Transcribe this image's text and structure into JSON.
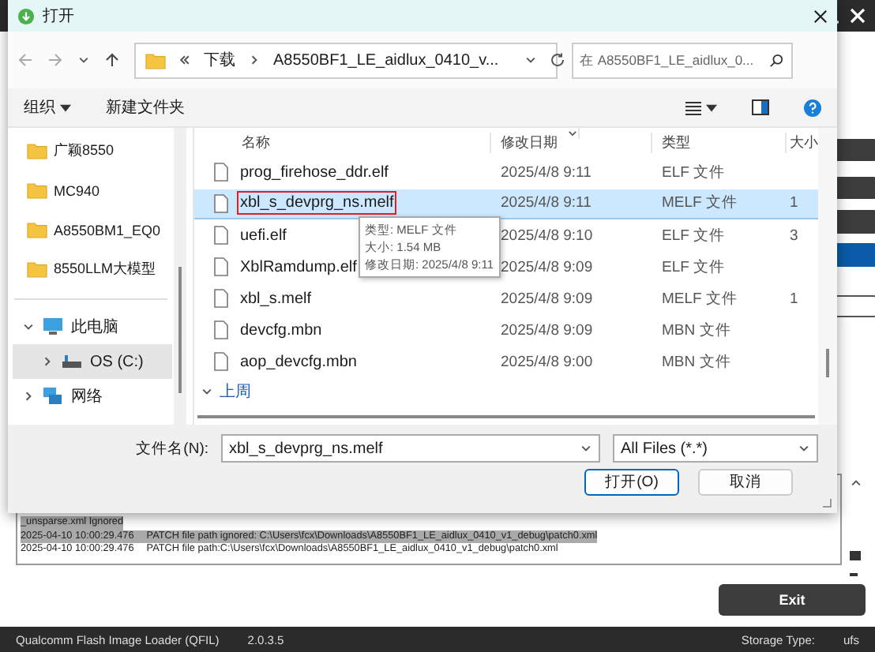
{
  "app": {
    "log_lines": [
      {
        "message": "_unsparse.xml Ignored",
        "selected": true
      },
      {
        "time": "2025-04-10 10:00:29.476",
        "message": "PATCH file path ignored: C:\\Users\\fcx\\Downloads\\A8550BF1_LE_aidlux_0410_v1_debug\\patch0.xml",
        "selected": true
      },
      {
        "time": "2025-04-10 10:00:29.476",
        "message": "PATCH file path:C:\\Users\\fcx\\Downloads\\A8550BF1_LE_aidlux_0410_v1_debug\\patch0.xml",
        "selected": false
      }
    ],
    "exit_button": "Exit",
    "status_bar": {
      "app_name": "Qualcomm Flash Image Loader (QFIL)",
      "version": "2.0.3.5",
      "storage_label": "Storage Type:",
      "storage_value": "ufs"
    }
  },
  "dialog": {
    "title": "打开",
    "breadcrumb": [
      "下载",
      "A8550BF1_LE_aidlux_0410_v..."
    ],
    "search": {
      "placeholder": "在 A8550BF1_LE_aidlux_0..."
    },
    "toolbar": {
      "organize": "组织",
      "new_folder": "新建文件夹"
    },
    "quick_access": [
      {
        "label": "广颖8550"
      },
      {
        "label": "MC940"
      },
      {
        "label": "A8550BM1_EQ0"
      },
      {
        "label": "8550LLM大模型"
      }
    ],
    "tree": [
      {
        "label": "此电脑",
        "expanded": true,
        "selected": false,
        "children": [
          {
            "label": "OS (C:)",
            "expanded": false,
            "selected": true
          }
        ]
      },
      {
        "label": "网络",
        "expanded": false,
        "selected": false
      }
    ],
    "columns": [
      "名称",
      "修改日期",
      "类型",
      "大小"
    ],
    "files": [
      {
        "name": "prog_firehose_ddr.elf",
        "date": "2025/4/8 9:11",
        "type": "ELF 文件",
        "selected": false,
        "annotated": false
      },
      {
        "name": "xbl_s_devprg_ns.melf",
        "date": "2025/4/8 9:11",
        "type": "MELF 文件",
        "size": "1",
        "selected": true,
        "annotated": true
      },
      {
        "name": "uefi.elf",
        "date": "2025/4/8 9:10",
        "type": "ELF 文件",
        "size": "3",
        "selected": false,
        "annotated": false
      },
      {
        "name": "XblRamdump.elf",
        "date": "2025/4/8 9:09",
        "type": "ELF 文件",
        "selected": false,
        "annotated": false
      },
      {
        "name": "xbl_s.melf",
        "date": "2025/4/8 9:09",
        "type": "MELF 文件",
        "size": "1",
        "selected": false,
        "annotated": false
      },
      {
        "name": "devcfg.mbn",
        "date": "2025/4/8 9:09",
        "type": "MBN 文件",
        "selected": false,
        "annotated": false
      },
      {
        "name": "aop_devcfg.mbn",
        "date": "2025/4/8 9:00",
        "type": "MBN 文件",
        "selected": false,
        "annotated": false
      }
    ],
    "group": {
      "label": "上周",
      "expanded": true
    },
    "tooltip": [
      "类型: MELF 文件",
      "大小: 1.54 MB",
      "修改日期: 2025/4/8 9:11"
    ],
    "filename": {
      "label": "文件名(N):",
      "value": "xbl_s_devprg_ns.melf"
    },
    "filter": {
      "value": "All Files (*.*)"
    },
    "buttons": [
      {
        "label": "打开(O)",
        "default": true
      },
      {
        "label": "取消",
        "default": false
      }
    ]
  }
}
